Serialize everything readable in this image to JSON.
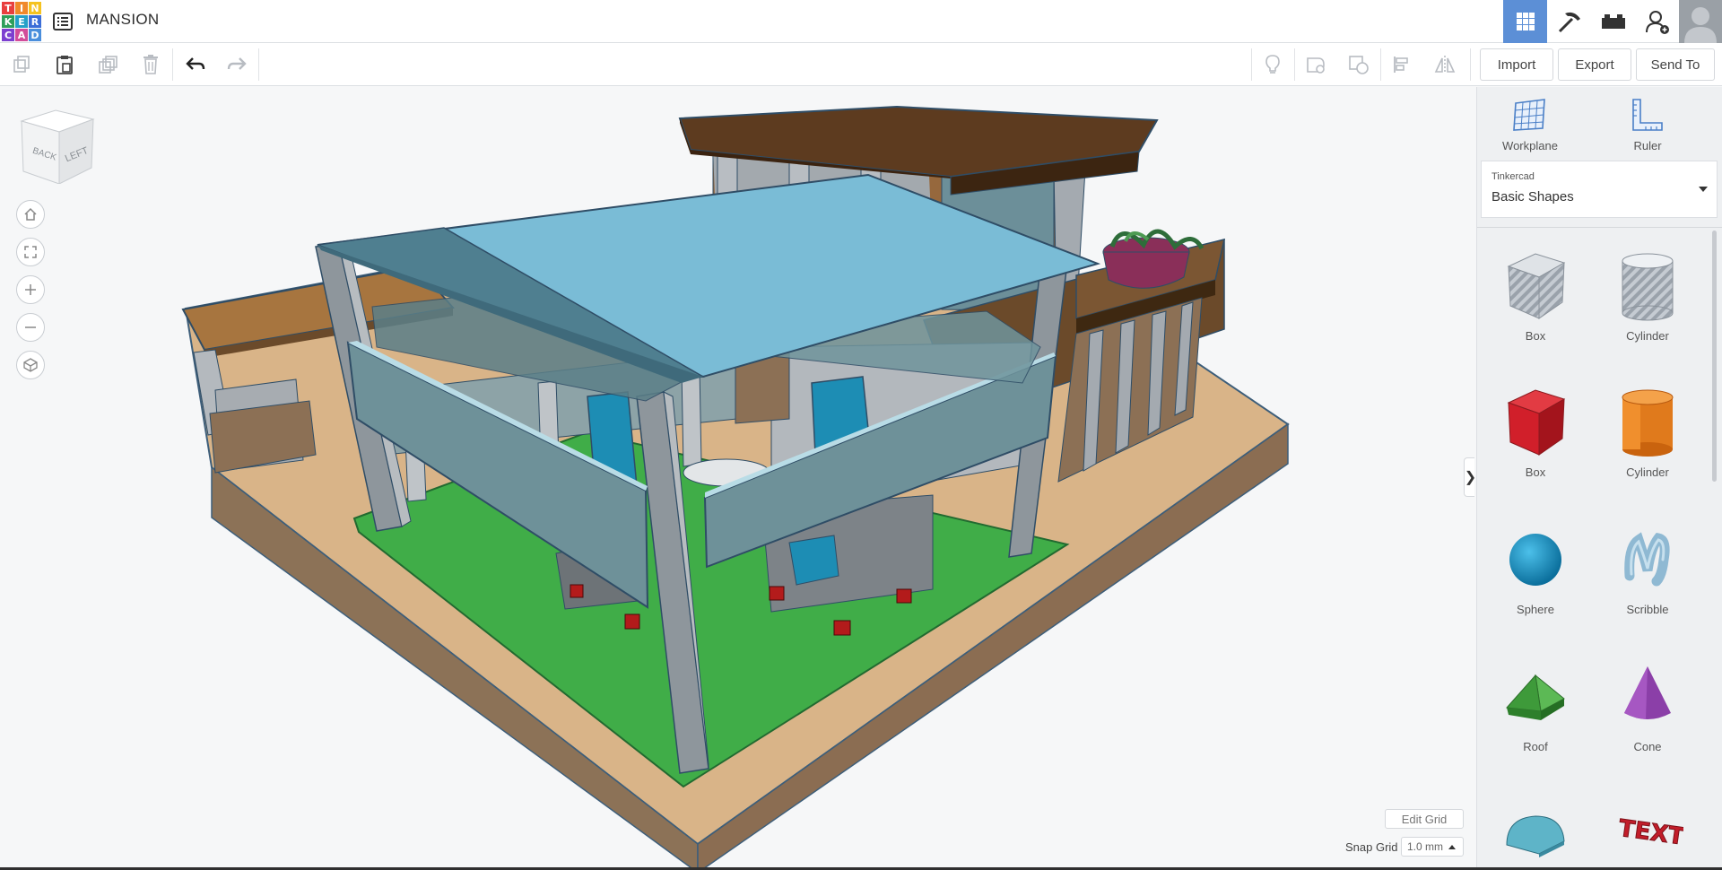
{
  "app": {
    "logo_letters": [
      "T",
      "I",
      "N",
      "K",
      "E",
      "R",
      "C",
      "A",
      "D"
    ],
    "logo_colors": [
      "#e83f3f",
      "#f0892a",
      "#f5c320",
      "#2e9e5a",
      "#25a0c8",
      "#3c6ed8",
      "#7c3fd0",
      "#d24c9a",
      "#4a8edc"
    ],
    "project_title": "MANSION",
    "accent_color": "#5c8fd6"
  },
  "topbar": {
    "icons": [
      "3d-view-icon",
      "pickaxe-icon",
      "bricks-icon",
      "add-user-icon"
    ]
  },
  "toolbar": {
    "import_label": "Import",
    "export_label": "Export",
    "send_to_label": "Send To"
  },
  "viewcube": {
    "back_label": "BACK",
    "left_label": "LEFT"
  },
  "viewport": {
    "edit_grid_label": "Edit Grid",
    "snap_grid_label": "Snap Grid",
    "snap_grid_value": "1.0 mm",
    "collapse_glyph": "❯"
  },
  "sidebar": {
    "workplane_label": "Workplane",
    "ruler_label": "Ruler",
    "library_source": "Tinkercad",
    "library_name": "Basic Shapes",
    "shapes": [
      {
        "label": "Box",
        "icon": "hole-box-icon"
      },
      {
        "label": "Cylinder",
        "icon": "hole-cylinder-icon"
      },
      {
        "label": "Box",
        "icon": "box-icon"
      },
      {
        "label": "Cylinder",
        "icon": "cylinder-icon"
      },
      {
        "label": "Sphere",
        "icon": "sphere-icon"
      },
      {
        "label": "Scribble",
        "icon": "scribble-icon"
      },
      {
        "label": "Roof",
        "icon": "roof-icon"
      },
      {
        "label": "Cone",
        "icon": "cone-icon"
      },
      {
        "label": "",
        "icon": "round-roof-icon"
      },
      {
        "label": "",
        "icon": "text-icon"
      }
    ],
    "text_shape_glyph": "TEXT"
  }
}
